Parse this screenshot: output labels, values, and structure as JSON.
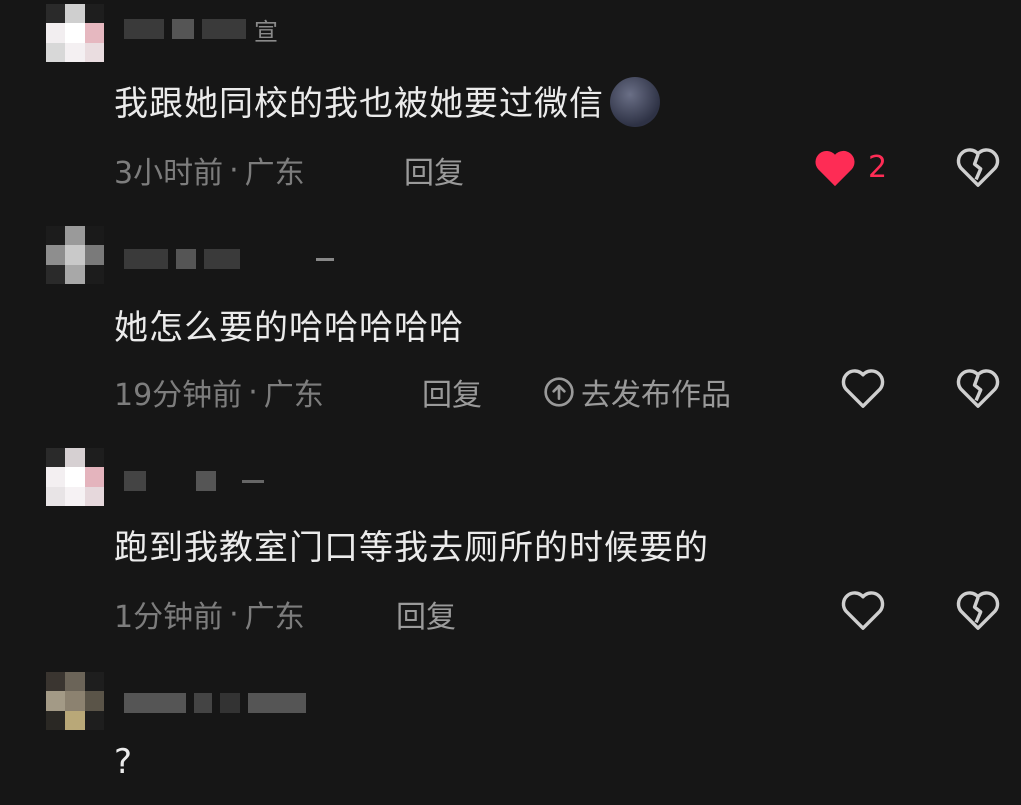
{
  "comments": [
    {
      "text": "我跟她同校的我也被她要过微信",
      "emoji": "new-moon-face-emoji",
      "time": "3小时前",
      "location": "广东",
      "reply_label": "回复",
      "likes": "2",
      "liked": true,
      "username_fragment": "宣"
    },
    {
      "text": "她怎么要的哈哈哈哈哈",
      "time": "19分钟前",
      "location": "广东",
      "reply_label": "回复",
      "publish_label": "去发布作品"
    },
    {
      "text": "跑到我教室门口等我去厕所的时候要的",
      "time": "1分钟前",
      "location": "广东",
      "reply_label": "回复"
    },
    {
      "text": "?"
    }
  ],
  "separator": "·",
  "colors": {
    "background": "#161616",
    "liked": "#fe2c55",
    "meta": "#7d7d7d"
  }
}
